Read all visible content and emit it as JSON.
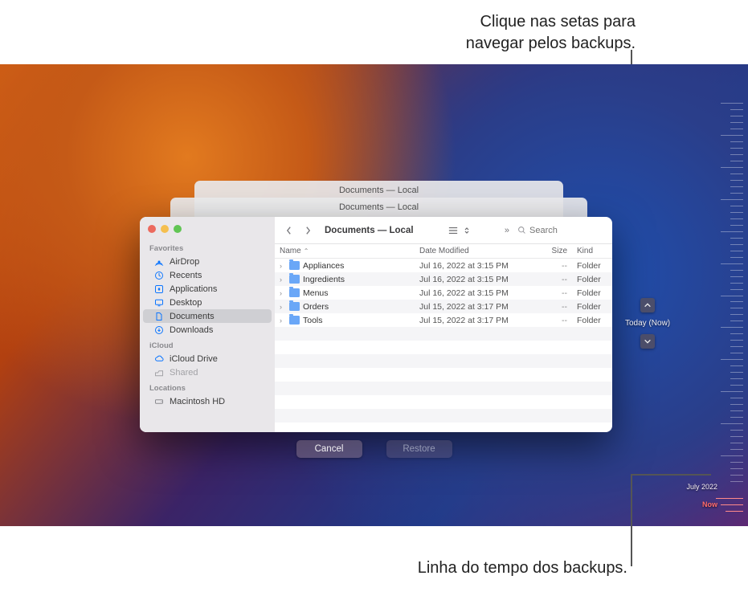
{
  "annotations": {
    "top": "Clique nas setas para\nnavegar pelos backups.",
    "bottom": "Linha do tempo dos backups."
  },
  "finder": {
    "title": "Documents — Local",
    "back_window_title1": "Documents — Local",
    "back_window_title2": "Documents — Local",
    "search_placeholder": "Search",
    "more_glyph": "»",
    "columns": {
      "name": "Name",
      "date": "Date Modified",
      "size": "Size",
      "kind": "Kind"
    },
    "sidebar": {
      "sections": [
        {
          "header": "Favorites",
          "items": [
            {
              "icon": "airdrop",
              "label": "AirDrop"
            },
            {
              "icon": "clock",
              "label": "Recents"
            },
            {
              "icon": "apps",
              "label": "Applications"
            },
            {
              "icon": "desktop",
              "label": "Desktop"
            },
            {
              "icon": "doc",
              "label": "Documents",
              "active": true
            },
            {
              "icon": "download",
              "label": "Downloads"
            }
          ]
        },
        {
          "header": "iCloud",
          "items": [
            {
              "icon": "cloud",
              "label": "iCloud Drive"
            },
            {
              "icon": "shared",
              "label": "Shared",
              "dim": true
            }
          ]
        },
        {
          "header": "Locations",
          "items": [
            {
              "icon": "hd",
              "label": "Macintosh HD"
            }
          ]
        }
      ]
    },
    "rows": [
      {
        "name": "Appliances",
        "date": "Jul 16, 2022 at 3:15 PM",
        "size": "--",
        "kind": "Folder"
      },
      {
        "name": "Ingredients",
        "date": "Jul 16, 2022 at 3:15 PM",
        "size": "--",
        "kind": "Folder"
      },
      {
        "name": "Menus",
        "date": "Jul 16, 2022 at 3:15 PM",
        "size": "--",
        "kind": "Folder"
      },
      {
        "name": "Orders",
        "date": "Jul 15, 2022 at 3:17 PM",
        "size": "--",
        "kind": "Folder"
      },
      {
        "name": "Tools",
        "date": "Jul 15, 2022 at 3:17 PM",
        "size": "--",
        "kind": "Folder"
      }
    ]
  },
  "time_machine": {
    "today_label": "Today (Now)",
    "cancel": "Cancel",
    "restore": "Restore",
    "timeline": {
      "month": "July 2022",
      "now": "Now"
    }
  }
}
